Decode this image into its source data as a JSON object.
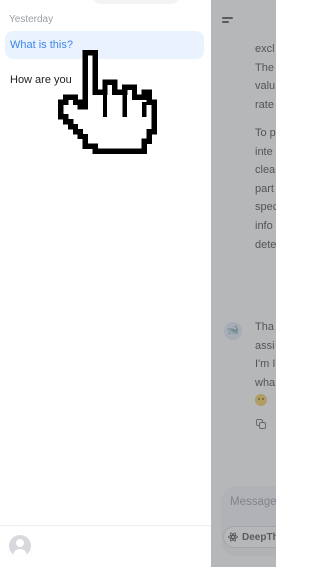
{
  "drawer": {
    "section_label": "Yesterday",
    "conversations": [
      {
        "title": "What is this?",
        "selected": true
      },
      {
        "title": "How are you",
        "selected": false
      }
    ],
    "footer": {
      "avatar_icon": "user-avatar-icon"
    }
  },
  "chat": {
    "menu_icon": "menu-icon",
    "message_1_lines": [
      "excl",
      "The",
      "valu",
      "rate"
    ],
    "message_2_lines": [
      "To p",
      "inte",
      "clea",
      "part",
      "spec",
      "info",
      "dete"
    ],
    "assistant_avatar_icon": "whale-logo-icon",
    "assistant_lines": [
      "Tha",
      "assi",
      "I'm I",
      "wha"
    ],
    "copy_icon": "copy-icon",
    "input_placeholder": "Message",
    "deepthink_label": "DeepTh"
  },
  "overlay": {
    "cursor_icon": "hand-pointer-icon"
  },
  "colors": {
    "selected_bg": "#eaf2fe",
    "selected_text": "#3c86e8",
    "dim_overlay": "rgba(120,123,128,0.55)",
    "brand": "#4d6bfe"
  }
}
